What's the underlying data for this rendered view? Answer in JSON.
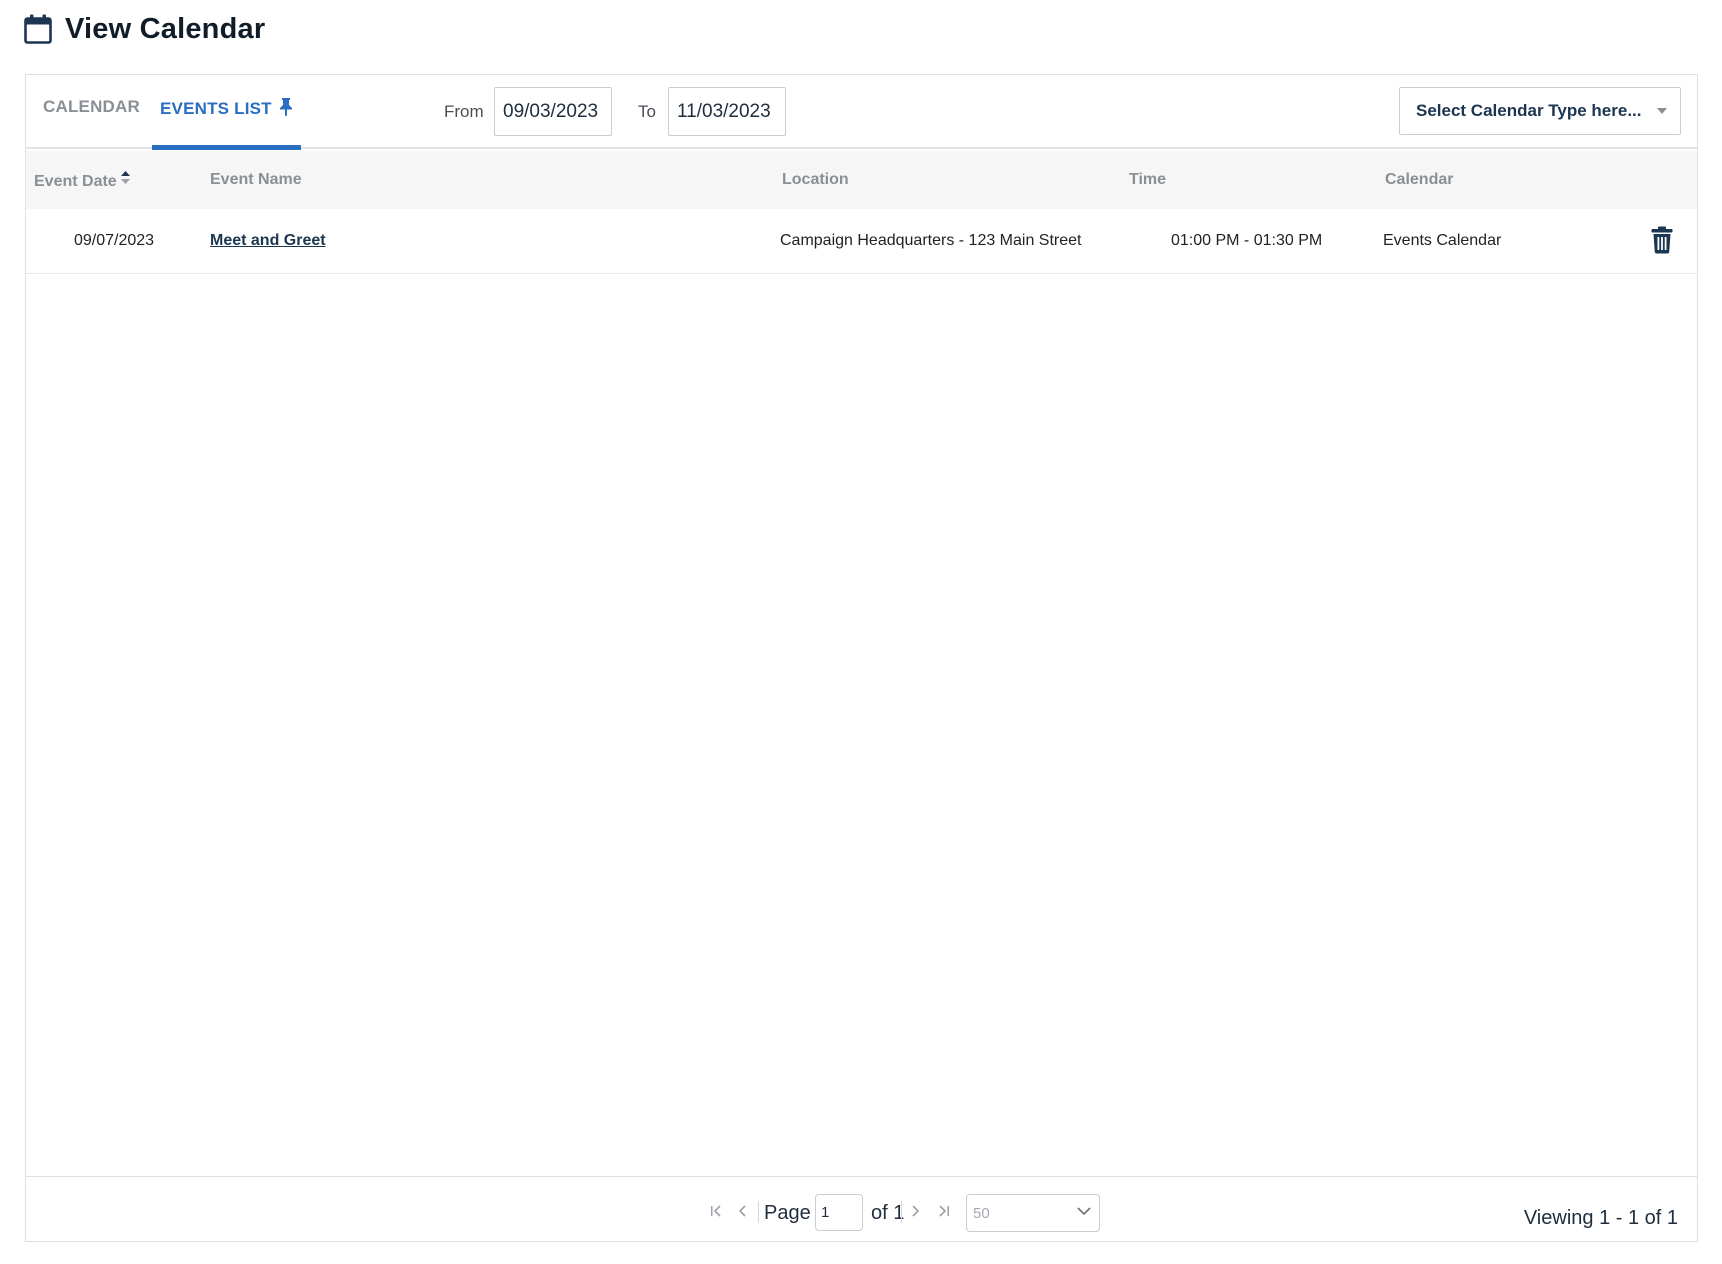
{
  "page": {
    "title": "View Calendar",
    "icon": "calendar-icon"
  },
  "tabs": [
    {
      "label": "CALENDAR",
      "active": false
    },
    {
      "label": "EVENTS LIST",
      "active": true,
      "icon": "pin-icon"
    }
  ],
  "filters": {
    "from_label": "From",
    "from_value": "09/03/2023",
    "to_label": "To",
    "to_value": "11/03/2023",
    "calendar_type_placeholder": "Select Calendar Type here..."
  },
  "table": {
    "columns": [
      "Event Date",
      "Event Name",
      "Location",
      "Time",
      "Calendar"
    ],
    "sorted_column": "Event Date",
    "rows": [
      {
        "event_date": "09/07/2023",
        "event_name": "Meet and Greet",
        "location": "Campaign Headquarters - 123 Main Street",
        "time": "01:00 PM - 01:30 PM",
        "calendar": "Events Calendar",
        "action_icon": "trash-icon"
      }
    ]
  },
  "pagination": {
    "page_label": "Page",
    "current_page": "1",
    "of_label": "of 1",
    "page_size": "50",
    "viewing": "Viewing 1 - 1 of 1"
  },
  "colors": {
    "accent": "#2a6ec2",
    "link": "#1a3650",
    "muted": "#8a8f96"
  }
}
